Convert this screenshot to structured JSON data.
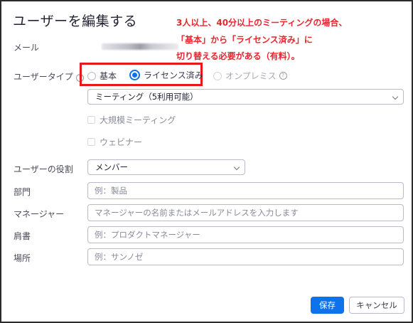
{
  "dialog": {
    "title": "ユーザーを編集する"
  },
  "annotation": {
    "lines": [
      "3人以上、40分以上のミーティングの場合、",
      "「基本」から「ライセンス済み」に",
      "切り替える必要がある（有料）。"
    ],
    "color": "#e8262d"
  },
  "fields": {
    "email_label": "メール",
    "user_type_label": "ユーザータイプ",
    "user_type_options": [
      "基本",
      "ライセンス済み",
      "オンプレミス"
    ],
    "user_type_selected": "ライセンス済み",
    "meeting_select_value": "ミーティング（5利用可能）",
    "large_meeting_label": "大規模ミーティング",
    "webinar_label": "ウェビナー",
    "role_label": "ユーザーの役割",
    "role_value": "メンバー",
    "department_label": "部門",
    "department_placeholder": "例：製品",
    "manager_label": "マネージャー",
    "manager_placeholder": "マネージャーの名前またはメールアドレスを入力します",
    "job_title_label": "肩書",
    "job_title_placeholder": "例：プロダクトマネージャー",
    "location_label": "場所",
    "location_placeholder": "例：サンノゼ"
  },
  "buttons": {
    "save": "保存",
    "cancel": "キャンセル"
  },
  "colors": {
    "accent": "#0e72ed",
    "highlight_box": "#e8161d"
  },
  "icons": {
    "help": "help-circle-icon",
    "dropdown": "chevron-down-icon"
  }
}
